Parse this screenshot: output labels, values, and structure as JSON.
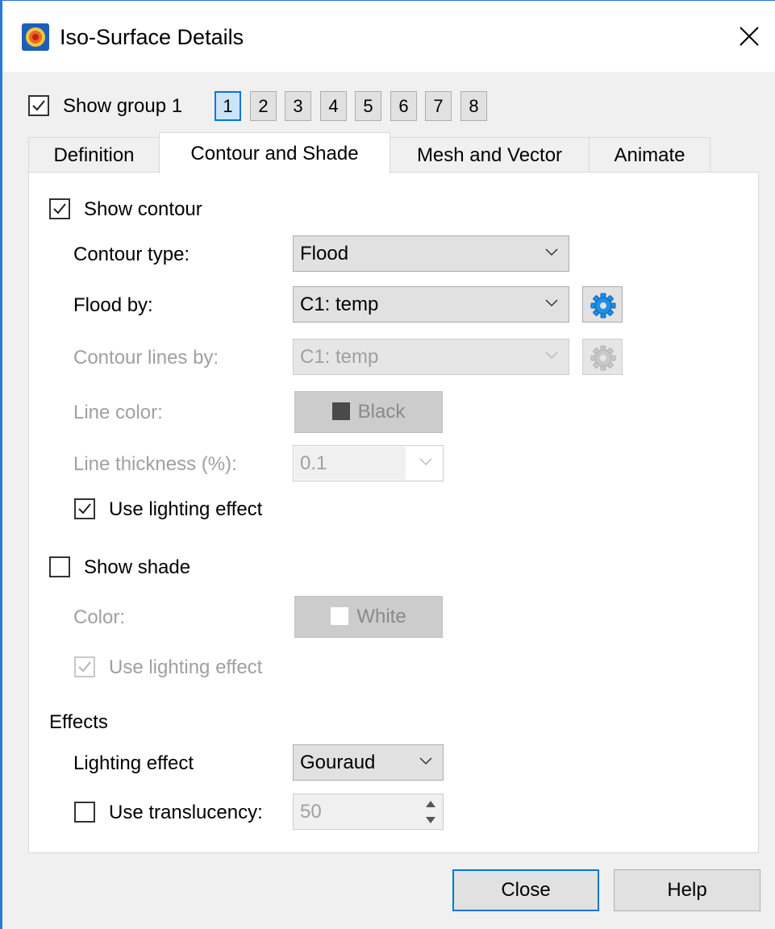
{
  "window": {
    "title": "Iso-Surface Details"
  },
  "group": {
    "show_label": "Show group 1",
    "show_checked": true,
    "numbers": [
      "1",
      "2",
      "3",
      "4",
      "5",
      "6",
      "7",
      "8"
    ],
    "selected": "1"
  },
  "tabs": [
    {
      "label": "Definition",
      "active": false
    },
    {
      "label": "Contour and Shade",
      "active": true
    },
    {
      "label": "Mesh and Vector",
      "active": false
    },
    {
      "label": "Animate",
      "active": false
    }
  ],
  "contour": {
    "show_label": "Show contour",
    "show_checked": true,
    "type_label": "Contour type:",
    "type_value": "Flood",
    "flood_label": "Flood by:",
    "flood_value": "C1: temp",
    "lines_label": "Contour lines by:",
    "lines_value": "C1: temp",
    "line_color_label": "Line color:",
    "line_color_value": "Black",
    "line_color_swatch": "#4a4a4a",
    "thickness_label": "Line thickness (%):",
    "thickness_value": "0.1",
    "lighting_label": "Use lighting effect",
    "lighting_checked": true
  },
  "shade": {
    "show_label": "Show shade",
    "show_checked": false,
    "color_label": "Color:",
    "color_value": "White",
    "color_swatch": "#ffffff",
    "lighting_label": "Use lighting effect",
    "lighting_checked": true
  },
  "effects": {
    "heading": "Effects",
    "lighting_label": "Lighting effect",
    "lighting_value": "Gouraud",
    "translucency_label": "Use translucency:",
    "translucency_checked": false,
    "translucency_value": "50"
  },
  "footer": {
    "close_label": "Close",
    "help_label": "Help"
  },
  "colors": {
    "accent": "#0078d7",
    "gear": "#1e90e8",
    "disabled_text": "#a0a0a0"
  }
}
